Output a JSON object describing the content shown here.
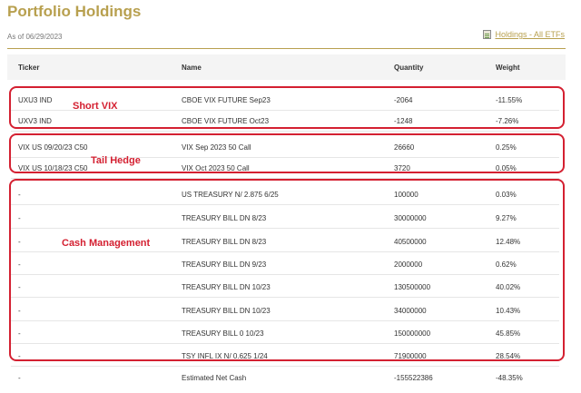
{
  "page": {
    "title": "Portfolio Holdings",
    "as_of": "As of 06/29/2023",
    "link_label": "Holdings - All ETFs"
  },
  "table": {
    "headers": [
      "Ticker",
      "Name",
      "Quantity",
      "Weight"
    ],
    "rows": [
      {
        "ticker": "UXU3 IND",
        "name": "CBOE VIX FUTURE Sep23",
        "quantity": "-2064",
        "weight": "-11.55%"
      },
      {
        "ticker": "UXV3 IND",
        "name": "CBOE VIX FUTURE Oct23",
        "quantity": "-1248",
        "weight": "-7.26%"
      },
      {
        "ticker": "VIX US 09/20/23 C50",
        "name": "VIX Sep 2023 50 Call",
        "quantity": "26660",
        "weight": "0.25%"
      },
      {
        "ticker": "VIX US 10/18/23 C50",
        "name": "VIX Oct 2023 50 Call",
        "quantity": "3720",
        "weight": "0.05%"
      },
      {
        "ticker": "-",
        "name": "US TREASURY N/ 2.875 6/25",
        "quantity": "100000",
        "weight": "0.03%"
      },
      {
        "ticker": "-",
        "name": "TREASURY BILL DN 8/23",
        "quantity": "30000000",
        "weight": "9.27%"
      },
      {
        "ticker": "-",
        "name": "TREASURY BILL DN 8/23",
        "quantity": "40500000",
        "weight": "12.48%"
      },
      {
        "ticker": "-",
        "name": "TREASURY BILL DN 9/23",
        "quantity": "2000000",
        "weight": "0.62%"
      },
      {
        "ticker": "-",
        "name": "TREASURY BILL DN 10/23",
        "quantity": "130500000",
        "weight": "40.02%"
      },
      {
        "ticker": "-",
        "name": "TREASURY BILL DN 10/23",
        "quantity": "34000000",
        "weight": "10.43%"
      },
      {
        "ticker": "-",
        "name": "TREASURY BILL 0 10/23",
        "quantity": "150000000",
        "weight": "45.85%"
      },
      {
        "ticker": "-",
        "name": "TSY INFL IX N/ 0.625 1/24",
        "quantity": "71900000",
        "weight": "28.54%"
      },
      {
        "ticker": "-",
        "name": "Estimated Net Cash",
        "quantity": "-155522386",
        "weight": "-48.35%"
      }
    ]
  },
  "annotations": {
    "short_vix": "Short VIX",
    "tail_hedge": "Tail Hedge",
    "cash_management": "Cash Management",
    "color": "#d42031"
  },
  "colors": {
    "accent": "#b8a04f",
    "header_bg": "#f4f4f4"
  }
}
